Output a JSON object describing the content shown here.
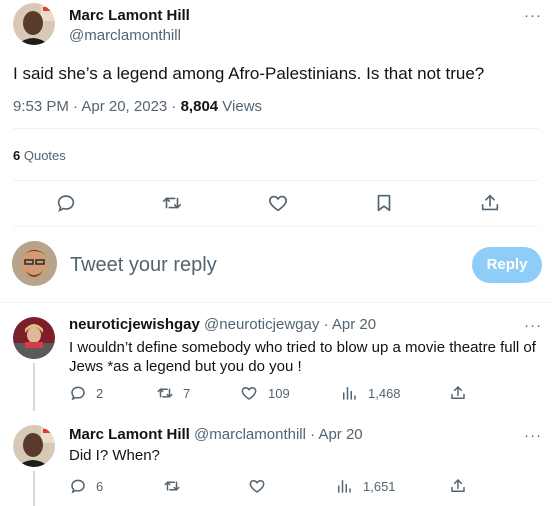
{
  "main_tweet": {
    "author_name": "Marc Lamont Hill",
    "author_handle": "@marclamonthill",
    "text": "I said she’s a legend among Afro-Palestinians. Is that not true?",
    "time": "9:53 PM · Apr 20, 2023 · ",
    "views_count": "8,804",
    "views_label": " Views",
    "quotes_count": "6",
    "quotes_label": " Quotes"
  },
  "composer": {
    "placeholder": "Tweet your reply",
    "reply_label": "Reply"
  },
  "replies": [
    {
      "author_name": "neuroticjewishgay",
      "author_handle": "@neuroticjewgay",
      "date": " · Apr 20",
      "text_line1": "I wouldn’t define somebody who tried to blow up a movie theatre full of",
      "text_line2": "Jews *as a legend but you do you !",
      "replies_count": "2",
      "retweets_count": "7",
      "likes_count": "109",
      "views_count": "1,468"
    },
    {
      "author_name": "Marc Lamont Hill",
      "author_handle": "@marclamonthill",
      "date": " · Apr 20",
      "text": "Did I? When?",
      "replies_count": "6",
      "views_count": "1,651"
    }
  ],
  "more_label": "···",
  "colors": {
    "text": "#0f1419",
    "muted": "#536471",
    "divider": "#eff3f4",
    "reply_button": "#8ecdf8"
  }
}
